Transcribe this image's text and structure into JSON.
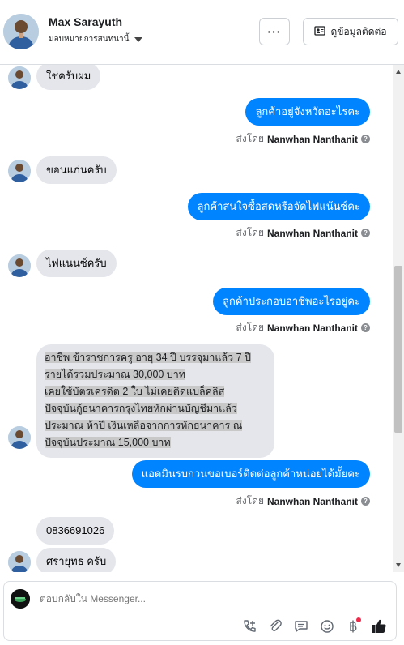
{
  "header": {
    "name": "Max Sarayuth",
    "subtitle": "มอบหมายการสนทนานี้",
    "more_label": "···",
    "contact_label": "ดูข้อมูลติดต่อ"
  },
  "messages": {
    "m1": "ใช่ครับผม",
    "m2": "ลูกค้าอยู่จังหวัดอะไรคะ",
    "m3": "ขอนแก่นครับ",
    "m4": "ลูกค้าสนใจซื้อสดหรือจัดไฟแน้นซ์คะ",
    "m5": "ไฟแนนซ์ครับ",
    "m6": "ลูกค้าประกอบอาชีพอะไรอยู่คะ",
    "m7_lines": [
      "อาชีพ ข้าราชการครู อายุ 34 ปี บรรจุมาแล้ว 7 ปี",
      "รายได้รวมประมาณ  30,000 บาท",
      "เคยใช้บัตรเครดิต 2 ใบ ไม่เคยติดแบล็คลิส",
      "ปัจจุบันกู้ธนาคารกรุงไทยหักผ่านบัญชีมาแล้ว",
      "ประมาณ ห้าปี  เงินเหลือจากการหักธนาคาร ณ",
      "ปัจจุบันประมาณ 15,000 บาท"
    ],
    "m8": "แอดมินรบกวนขอเบอร์ติดต่อลูกค้าหน่อยได้มั้ยคะ",
    "m9": "0836691026",
    "m10": "ศรายุทธ   ครับ"
  },
  "sent_by": {
    "prefix": "ส่งโดย",
    "name": "Nanwhan Nanthanit",
    "help": "?"
  },
  "composer": {
    "placeholder": "ตอบกลับใน Messenger..."
  },
  "icons": {
    "call": "phone-add-icon",
    "attach": "paperclip-icon",
    "saved": "saved-replies-icon",
    "emoji": "emoji-icon",
    "payment": "baht-icon",
    "like": "thumbs-up-icon"
  },
  "colors": {
    "outgoing": "#0084ff",
    "incoming": "#e4e6eb",
    "like": "#1c1e21"
  }
}
